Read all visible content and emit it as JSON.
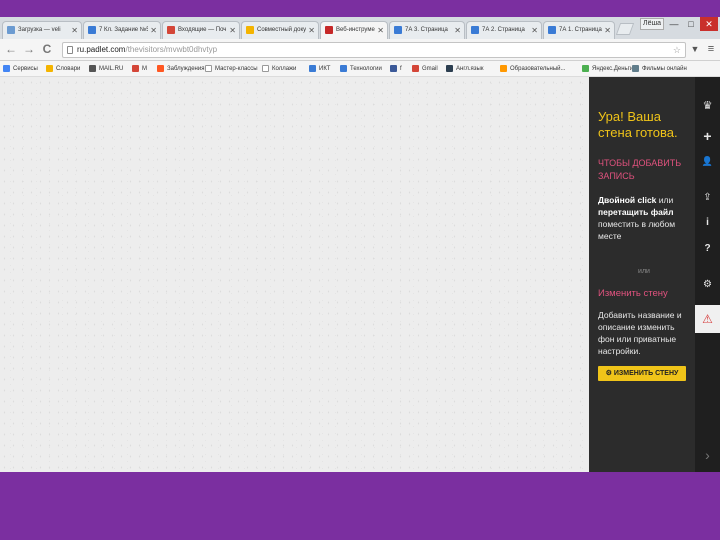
{
  "tabs": [
    {
      "title": "Загрузка — veli",
      "active": false,
      "color": "#6b9bd1"
    },
    {
      "title": "7 Кл. Задание №5",
      "active": false,
      "color": "#3a7bd5"
    },
    {
      "title": "Входящие — Поч",
      "active": false,
      "color": "#d44638"
    },
    {
      "title": "Совместный доку",
      "active": false,
      "color": "#f4b400"
    },
    {
      "title": "Веб-инструменты",
      "active": true,
      "color": "#c62828"
    },
    {
      "title": "7А 3. Страница",
      "active": false,
      "color": "#3a7bd5"
    },
    {
      "title": "7А 2. Страница",
      "active": false,
      "color": "#3a7bd5"
    },
    {
      "title": "7А 1. Страница",
      "active": false,
      "color": "#3a7bd5"
    }
  ],
  "window": {
    "user": "Лёша",
    "minimize": "—",
    "maximize": "□",
    "close": "✕"
  },
  "toolbar": {
    "back": "←",
    "forward": "→",
    "reload": "C",
    "url_host": "ru.padlet.com",
    "url_path": "/thevisitors/mvwbt0dhvtyp"
  },
  "bookmarks": [
    {
      "label": "Сервисы",
      "color": "#4285f4"
    },
    {
      "label": "Словари",
      "color": "#f4b400"
    },
    {
      "label": "MAIL.RU",
      "color": "#555555"
    },
    {
      "label": "M",
      "color": "#d44638"
    },
    {
      "label": "Заблуждения",
      "color": "#ff5722"
    },
    {
      "label": "Мастер-классы",
      "color": "#ffffff"
    },
    {
      "label": "Коллажи",
      "color": "#ffffff"
    },
    {
      "label": "ИКТ",
      "color": "#3a7bd5"
    },
    {
      "label": "Технологии",
      "color": "#3a7bd5"
    },
    {
      "label": "f",
      "color": "#3b5998"
    },
    {
      "label": "Gmail",
      "color": "#d44638"
    },
    {
      "label": "Англ.язык",
      "color": "#2c3e50"
    },
    {
      "label": "Образовательный...",
      "color": "#ff9800"
    },
    {
      "label": "Яндекс.Деньги",
      "color": "#4caf50"
    },
    {
      "label": "Фильмы онлайн",
      "color": "#607d8b"
    }
  ],
  "panel": {
    "heading": "Ура! Ваша стена готова.",
    "add_post_label": "ЧТОБЫ ДОБАВИТЬ ЗАПИСЬ",
    "add_post_text_bold1": "Двойной click",
    "add_post_text_1": " или ",
    "add_post_text_bold2": "перетащить файл",
    "add_post_text_2": " поместить в любом месте",
    "or": "или",
    "change_label": "Изменить стену",
    "change_text": "Добавить название и описание изменить фон или приватные настройки.",
    "change_button": "ИЗМЕНИТЬ СТЕНУ"
  },
  "iconbar": [
    {
      "icon": "padlet-logo-icon",
      "glyph": "♛"
    },
    {
      "icon": "plus-icon",
      "glyph": "+"
    },
    {
      "icon": "user-icon",
      "glyph": "👤"
    },
    {
      "icon": "share-icon",
      "glyph": "⇪"
    },
    {
      "icon": "info-icon",
      "glyph": "i"
    },
    {
      "icon": "help-icon",
      "glyph": "?"
    },
    {
      "icon": "gear-icon",
      "glyph": "⚙"
    },
    {
      "icon": "warning-icon",
      "glyph": "⚠"
    },
    {
      "icon": "chevron-right-icon",
      "glyph": "›"
    }
  ]
}
